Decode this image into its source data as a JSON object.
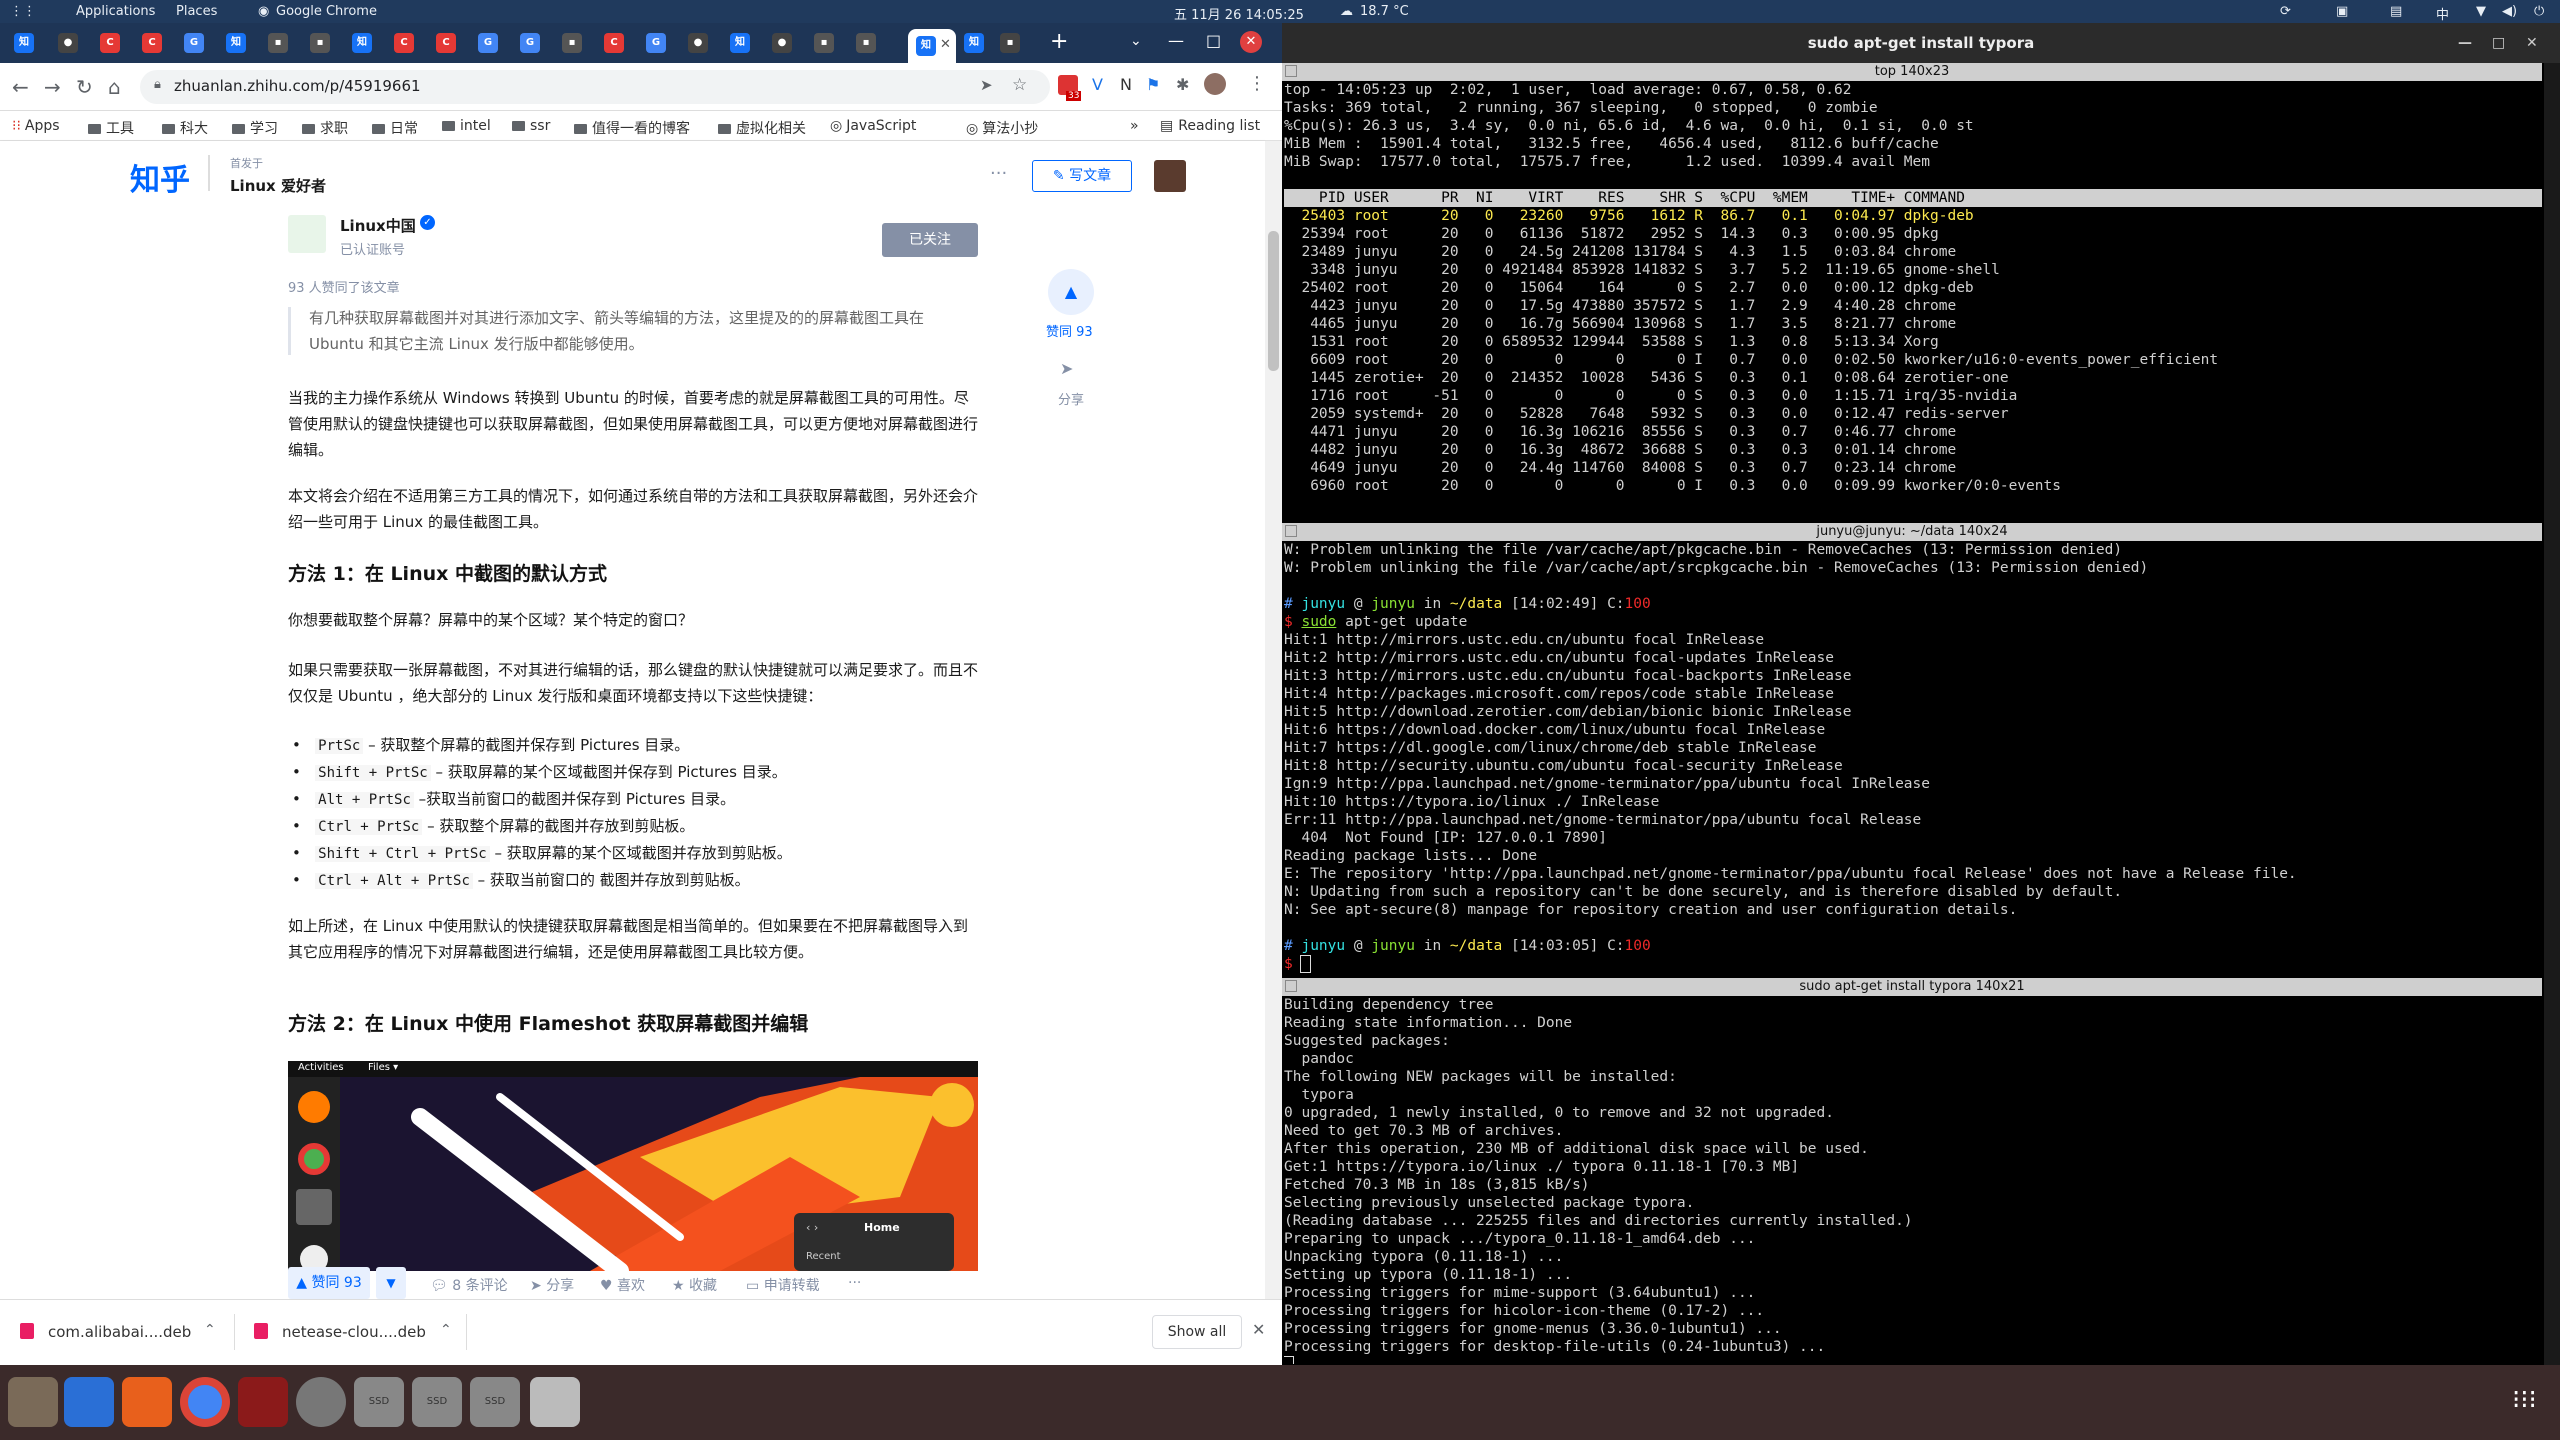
{
  "panel": {
    "applications": "Applications",
    "places": "Places",
    "active_app": "Google Chrome",
    "clock": "五 11月 26 14:05:25",
    "weather": "18.7 °C",
    "input_method": "中"
  },
  "chrome": {
    "url": "zhuanlan.zhihu.com/p/45919661",
    "bookmarks": [
      "Apps",
      "工具",
      "科大",
      "学习",
      "求职",
      "日常",
      "intel",
      "ssr",
      "值得一看的博客",
      "虚拟化相关",
      "JavaScript",
      "算法小抄"
    ],
    "reading_list": "Reading list",
    "ext_badge": "33"
  },
  "zhihu": {
    "logo": "知乎",
    "published_in": "首发于",
    "column_name": "Linux 爱好者",
    "write_button": "写文章",
    "author_name": "Linux中国",
    "author_badge": "已认证账号",
    "follow_button": "已关注",
    "likes_note": "93 人赞同了该文章",
    "abstract": "有几种获取屏幕截图并对其进行添加文字、箭头等编辑的方法，这里提及的的屏幕截图工具在 Ubuntu 和其它主流 Linux 发行版中都能够使用。",
    "para1": "当我的主力操作系统从 Windows 转换到 Ubuntu 的时候，首要考虑的就是屏幕截图工具的可用性。尽管使用默认的键盘快捷键也可以获取屏幕截图，但如果使用屏幕截图工具，可以更方便地对屏幕截图进行编辑。",
    "para2": "本文将会介绍在不适用第三方工具的情况下，如何通过系统自带的方法和工具获取屏幕截图，另外还会介绍一些可用于 Linux 的最佳截图工具。",
    "heading1": "方法 1：在 Linux 中截图的默认方式",
    "para3": "你想要截取整个屏幕？屏幕中的某个区域？某个特定的窗口？",
    "para4": "如果只需要获取一张屏幕截图，不对其进行编辑的话，那么键盘的默认快捷键就可以满足要求了。而且不仅仅是 Ubuntu ，绝大部分的 Linux 发行版和桌面环境都支持以下这些快捷键：",
    "shortcuts": [
      {
        "key": "PrtSc",
        "desc": " – 获取整个屏幕的截图并保存到 Pictures 目录。"
      },
      {
        "key": "Shift + PrtSc",
        "desc": " – 获取屏幕的某个区域截图并保存到 Pictures 目录。"
      },
      {
        "key": "Alt + PrtSc",
        "desc": " –获取当前窗口的截图并保存到 Pictures 目录。"
      },
      {
        "key": "Ctrl + PrtSc",
        "desc": " – 获取整个屏幕的截图并存放到剪贴板。"
      },
      {
        "key": "Shift + Ctrl + PrtSc",
        "desc": " – 获取屏幕的某个区域截图并存放到剪贴板。"
      },
      {
        "key": "Ctrl + Alt + PrtSc",
        "desc": " – 获取当前窗口的 截图并存放到剪贴板。"
      }
    ],
    "para5": "如上所述，在 Linux 中使用默认的快捷键获取屏幕截图是相当简单的。但如果要在不把屏幕截图导入到其它应用程序的情况下对屏幕截图进行编辑，还是使用屏幕截图工具比较方便。",
    "heading2": "方法 2：在 Linux 中使用 Flameshot 获取屏幕截图并编辑",
    "img_activities": "Activities",
    "img_files": "Files ▾",
    "img_home": "Home",
    "img_recent": "Recent",
    "side_like": "赞同 93",
    "side_share": "分享",
    "bottom_like": "赞同 93",
    "comments": "8 条评论",
    "share": "分享",
    "favorite": "喜欢",
    "collect": "收藏",
    "reprint": "申请转载",
    "more": "···"
  },
  "downloads": {
    "items": [
      "com.alibabai....deb",
      "netease-clou....deb"
    ],
    "show_all": "Show all"
  },
  "terminal": {
    "window_title": "sudo apt-get install typora",
    "pane1_title": "top 140x23",
    "pane2_title": "junyu@junyu: ~/data 140x24",
    "pane3_title": "sudo apt-get install typora 140x21",
    "top_lines": [
      "top - 14:05:23 up  2:02,  1 user,  load average: 0.67, 0.58, 0.62",
      "Tasks: 369 total,   2 running, 367 sleeping,   0 stopped,   0 zombie",
      "%Cpu(s): 26.3 us,  3.4 sy,  0.0 ni, 65.6 id,  4.6 wa,  0.0 hi,  0.1 si,  0.0 st",
      "MiB Mem :  15901.4 total,   3132.5 free,   4656.4 used,   8112.6 buff/cache",
      "MiB Swap:  17577.0 total,  17575.7 free,      1.2 used.  10399.4 avail Mem",
      ""
    ],
    "top_header": "    PID USER      PR  NI    VIRT    RES    SHR S  %CPU  %MEM     TIME+ COMMAND",
    "top_rows": [
      "  25403 root      20   0   23260   9756   1612 R  86.7   0.1   0:04.97 dpkg-deb",
      "  25394 root      20   0   61136  51872   2952 S  14.3   0.3   0:00.95 dpkg",
      "  23489 junyu     20   0   24.5g 241208 131784 S   4.3   1.5   0:03.84 chrome",
      "   3348 junyu     20   0 4921484 853928 141832 S   3.7   5.2  11:19.65 gnome-shell",
      "  25402 root      20   0   15064    164      0 S   2.7   0.0   0:00.12 dpkg-deb",
      "   4423 junyu     20   0   17.5g 473880 357572 S   1.7   2.9   4:40.28 chrome",
      "   4465 junyu     20   0   16.7g 566904 130968 S   1.7   3.5   8:21.77 chrome",
      "   1531 root      20   0 6589532 129944  53588 S   1.3   0.8   5:13.34 Xorg",
      "   6609 root      20   0       0      0      0 I   0.7   0.0   0:02.50 kworker/u16:0-events_power_efficient",
      "   1445 zerotie+  20   0  214352  10028   5436 S   0.3   0.1   0:08.64 zerotier-one",
      "   1716 root     -51   0       0      0      0 S   0.3   0.0   1:15.71 irq/35-nvidia",
      "   2059 systemd+  20   0   52828   7648   5932 S   0.3   0.0   0:12.47 redis-server",
      "   4471 junyu     20   0   16.3g 106216  85556 S   0.3   0.7   0:46.77 chrome",
      "   4482 junyu     20   0   16.3g  48672  36688 S   0.3   0.3   0:01.14 chrome",
      "   4649 junyu     20   0   24.4g 114760  84008 S   0.3   0.7   0:23.14 chrome",
      "   6960 root      20   0       0      0      0 I   0.3   0.0   0:09.99 kworker/0:0-events"
    ],
    "apt_update": {
      "pre": [
        "W: Problem unlinking the file /var/cache/apt/pkgcache.bin - RemoveCaches (13: Permission denied)",
        "W: Problem unlinking the file /var/cache/apt/srcpkgcache.bin - RemoveCaches (13: Permission denied)",
        ""
      ],
      "prompt1": {
        "user": "junyu",
        "host": "junyu",
        "dir": "~/data",
        "time": "[14:02:49]",
        "code": "C:100"
      },
      "cmd1_sudo": "sudo",
      "cmd1_rest": " apt-get update",
      "output": [
        "Hit:1 http://mirrors.ustc.edu.cn/ubuntu focal InRelease",
        "Hit:2 http://mirrors.ustc.edu.cn/ubuntu focal-updates InRelease",
        "Hit:3 http://mirrors.ustc.edu.cn/ubuntu focal-backports InRelease",
        "Hit:4 http://packages.microsoft.com/repos/code stable InRelease",
        "Hit:5 http://download.zerotier.com/debian/bionic bionic InRelease",
        "Hit:6 https://download.docker.com/linux/ubuntu focal InRelease",
        "Hit:7 https://dl.google.com/linux/chrome/deb stable InRelease",
        "Hit:8 http://security.ubuntu.com/ubuntu focal-security InRelease",
        "Ign:9 http://ppa.launchpad.net/gnome-terminator/ppa/ubuntu focal InRelease",
        "Hit:10 https://typora.io/linux ./ InRelease",
        "Err:11 http://ppa.launchpad.net/gnome-terminator/ppa/ubuntu focal Release",
        "  404  Not Found [IP: 127.0.0.1 7890]",
        "Reading package lists... Done",
        "E: The repository 'http://ppa.launchpad.net/gnome-terminator/ppa/ubuntu focal Release' does not have a Release file.",
        "N: Updating from such a repository can't be done securely, and is therefore disabled by default.",
        "N: See apt-secure(8) manpage for repository creation and user configuration details.",
        ""
      ],
      "prompt2": {
        "user": "junyu",
        "host": "junyu",
        "dir": "~/data",
        "time": "[14:03:05]",
        "code": "C:100"
      }
    },
    "install_lines": [
      "Building dependency tree",
      "Reading state information... Done",
      "Suggested packages:",
      "  pandoc",
      "The following NEW packages will be installed:",
      "  typora",
      "0 upgraded, 1 newly installed, 0 to remove and 32 not upgraded.",
      "Need to get 70.3 MB of archives.",
      "After this operation, 230 MB of additional disk space will be used.",
      "Get:1 https://typora.io/linux ./ typora 0.11.18-1 [70.3 MB]",
      "Fetched 70.3 MB in 18s (3,815 kB/s)",
      "Selecting previously unselected package typora.",
      "(Reading database ... 225255 files and directories currently installed.)",
      "Preparing to unpack .../typora_0.11.18-1_amd64.deb ...",
      "Unpacking typora (0.11.18-1) ...",
      "Setting up typora (0.11.18-1) ...",
      "Processing triggers for mime-support (3.64ubuntu1) ...",
      "Processing triggers for hicolor-icon-theme (0.17-2) ...",
      "Processing triggers for gnome-menus (3.36.0-1ubuntu1) ...",
      "Processing triggers for desktop-file-utils (0.24-1ubuntu3) ..."
    ]
  },
  "dock": {
    "drive_label": "SSD"
  },
  "colors": {
    "panel": "#203a5d",
    "zhihu_blue": "#0066ff",
    "prompt_green": "#8ae234",
    "prompt_blue": "#5c9cff",
    "prompt_red": "#ef2929"
  }
}
